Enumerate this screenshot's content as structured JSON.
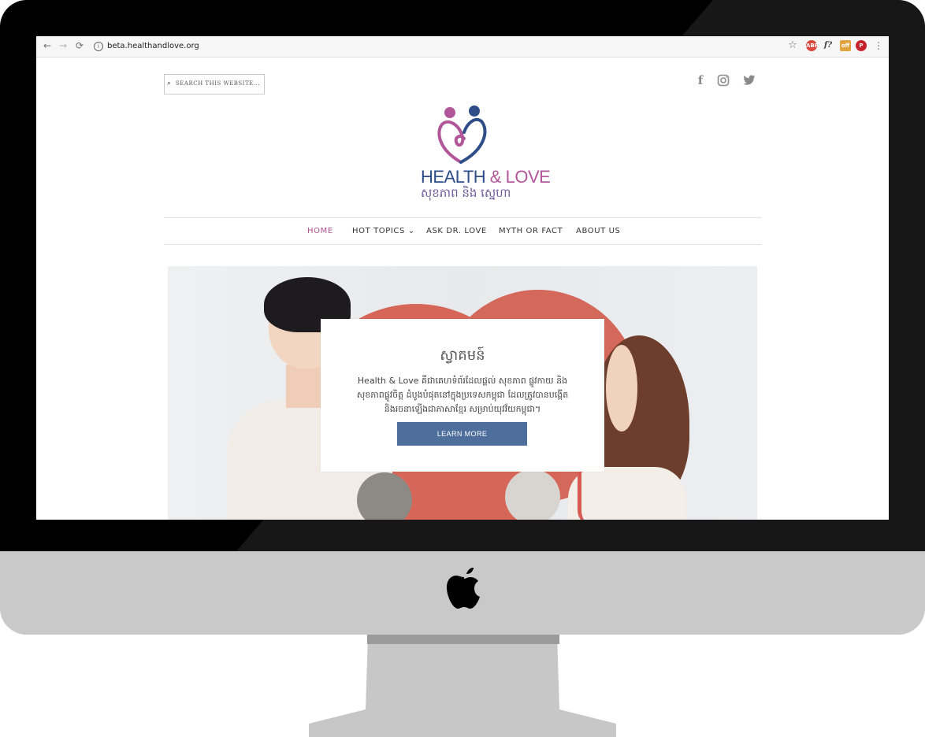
{
  "browser": {
    "url": "beta.healthandlove.org",
    "back_glyph": "←",
    "forward_glyph": "→",
    "reload_glyph": "⟳",
    "info_glyph": "i",
    "star_glyph": "☆",
    "menu_glyph": "⋮",
    "extensions": [
      {
        "name": "adblock-plus",
        "label": "ABP",
        "color": "#d9473b"
      },
      {
        "name": "font-ext",
        "label": "f?",
        "color": "#555555"
      },
      {
        "name": "off-ext",
        "label": "off",
        "color": "#e2a23d"
      },
      {
        "name": "pinterest",
        "label": "P",
        "color": "#c8232c"
      }
    ]
  },
  "header": {
    "search_placeholder": "SEARCH THIS WEBSITE...",
    "social": [
      {
        "name": "facebook-icon",
        "glyph": "f"
      },
      {
        "name": "instagram-icon",
        "glyph": "◎"
      },
      {
        "name": "twitter-icon",
        "glyph": "🐦"
      }
    ]
  },
  "logo": {
    "text_en_1": "HEALTH",
    "text_en_amp": "&",
    "text_en_2": "LOVE",
    "text_km": "សុខភាព និង ស្នេហា",
    "colors": {
      "pink": "#b2569a",
      "navy": "#2f4d88"
    }
  },
  "nav": {
    "items": [
      {
        "label": "HOME",
        "active": true
      },
      {
        "label": "HOT TOPICS",
        "dropdown": "⌄"
      },
      {
        "label": "ASK DR. LOVE"
      },
      {
        "label": "MYTH OR FACT"
      },
      {
        "label": "ABOUT US"
      }
    ]
  },
  "hero": {
    "title": "ស្វាគមន៍",
    "text": "Health & Love គឺជាគេហទំព័រដែលផ្តល់ សុខភាព ផ្លូវកាយ និង សុខភាពផ្លូវចិត្ត ដំបូងបំផុតនៅក្នុងប្រទេសកម្ពុជា ដែលត្រូវបានបង្កើត និងរចនាឡើងជាភាសាខ្មែរ សម្រាប់យុវវ័យកម្ពុជា។",
    "button": "LEARN MORE",
    "button_color": "#4e6e9c"
  },
  "device": {
    "logo": "apple-logo"
  }
}
